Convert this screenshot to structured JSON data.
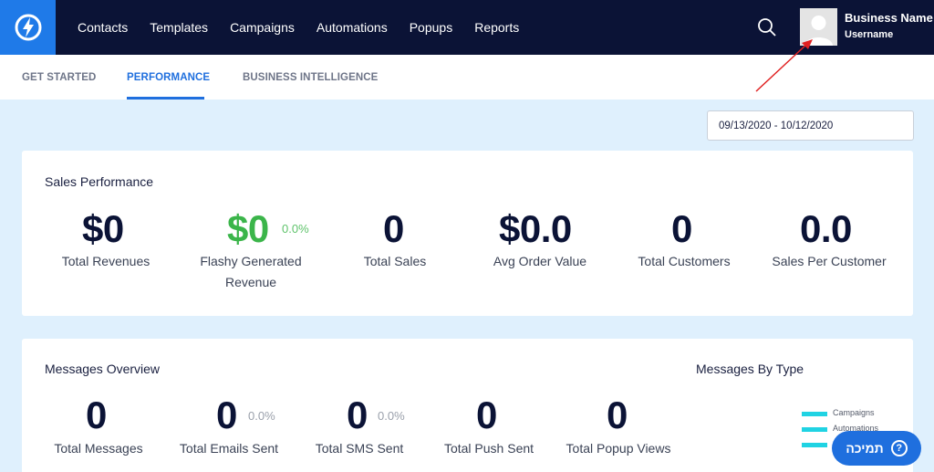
{
  "nav": {
    "items": [
      "Contacts",
      "Templates",
      "Campaigns",
      "Automations",
      "Popups",
      "Reports"
    ]
  },
  "user": {
    "name": "Business Name",
    "username": "Username"
  },
  "tabs": [
    {
      "label": "GET STARTED",
      "active": false
    },
    {
      "label": "PERFORMANCE",
      "active": true
    },
    {
      "label": "BUSINESS INTELLIGENCE",
      "active": false
    }
  ],
  "date_range": "09/13/2020 - 10/12/2020",
  "sales": {
    "title": "Sales Performance",
    "metrics": [
      {
        "value": "$0",
        "label": "Total Revenues"
      },
      {
        "value": "$0",
        "pct": "0.0%",
        "label_line1": "Flashy Generated",
        "label_line2": "Revenue"
      },
      {
        "value": "0",
        "label": "Total Sales"
      },
      {
        "value": "$0.0",
        "label": "Avg Order Value"
      },
      {
        "value": "0",
        "label": "Total Customers"
      },
      {
        "value": "0.0",
        "label": "Sales Per Customer"
      }
    ]
  },
  "messages": {
    "title": "Messages Overview",
    "by_type_title": "Messages By Type",
    "metrics": [
      {
        "value": "0",
        "label": "Total Messages"
      },
      {
        "value": "0",
        "pct": "0.0%",
        "label": "Total Emails Sent"
      },
      {
        "value": "0",
        "pct": "0.0%",
        "label": "Total SMS Sent"
      },
      {
        "value": "0",
        "label": "Total Push Sent"
      },
      {
        "value": "0",
        "label": "Total Popup Views"
      }
    ],
    "legend": [
      "Campaigns",
      "Automations"
    ]
  },
  "support": {
    "label": "תמיכה",
    "icon": "?"
  },
  "colors": {
    "nav_bg": "#0b1336",
    "accent": "#1f6fde",
    "green": "#3bb54a",
    "page_bg": "#dff0fd"
  }
}
